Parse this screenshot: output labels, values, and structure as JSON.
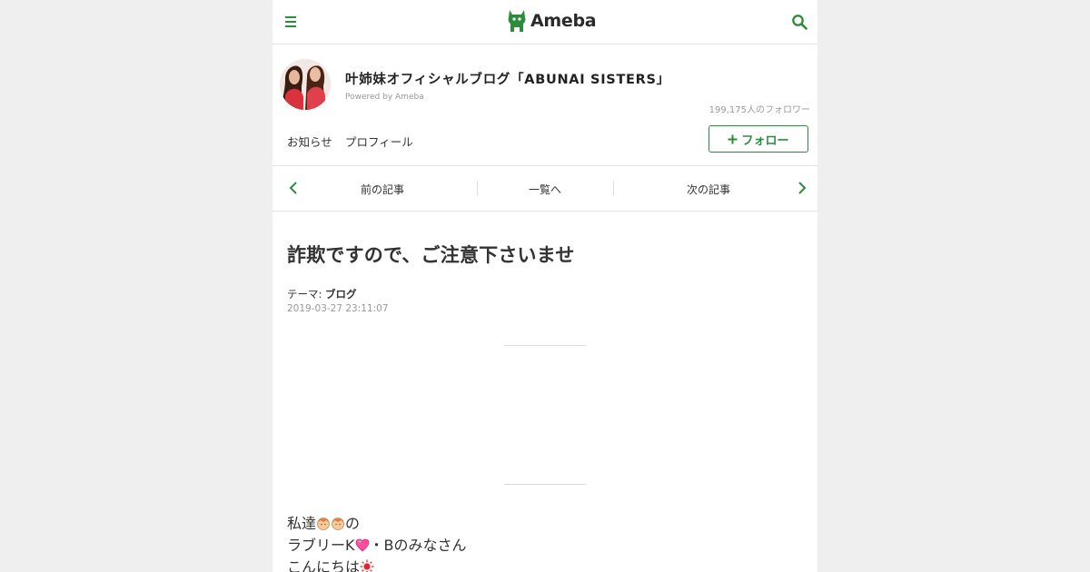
{
  "header": {
    "logo_text": "Ameba",
    "menu_icon": "hamburger-menu-icon",
    "search_icon": "search-icon",
    "accent_color": "#2d8c3c"
  },
  "blog": {
    "title": "叶姉妹オフィシャルブログ「ABUNAI SISTERS」",
    "powered_by": "Powered by Ameba",
    "followers": "199,175人のフォロワー",
    "nav": [
      "お知らせ",
      "プロフィール"
    ],
    "follow_label": "フォロー",
    "follow_icon": "plus-icon"
  },
  "pager": {
    "prev": "前の記事",
    "list": "一覧へ",
    "next": "次の記事"
  },
  "article": {
    "title": "詐欺ですので、ご注意下さいませ",
    "theme_label": "テーマ:",
    "theme_value": "ブログ",
    "date": "2019-03-27 23:11:07",
    "lines": [
      {
        "before": "私達",
        "emoji": [
          "face-emoji",
          "face-emoji"
        ],
        "after": "の"
      },
      {
        "before": "ラブリーK",
        "emoji": [
          "pink-heart-emoji"
        ],
        "after": "・Bのみなさん"
      },
      {
        "before": "こんにちは",
        "emoji": [
          "sun-emoji"
        ],
        "after": ""
      }
    ]
  }
}
